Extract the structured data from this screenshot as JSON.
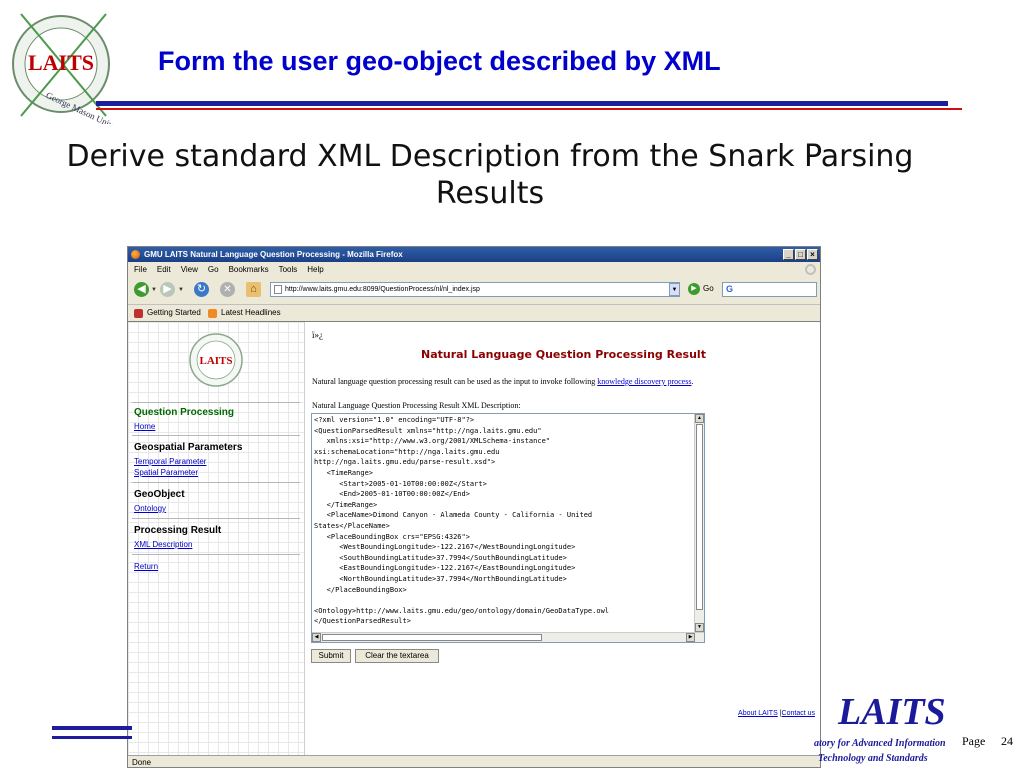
{
  "slide": {
    "title": "Form the user geo-object described by XML",
    "subtitle": "Derive standard XML Description from the Snark Parsing Results",
    "logo_text": "LAITS",
    "logo_ring_text": "George Mason University",
    "footer_brand": "LAITS",
    "footer_org_line1": "atory for Advanced Information",
    "footer_org_line2": "Technology and Standards",
    "page_label": "Page",
    "page_number": "24"
  },
  "browser": {
    "window_title": "GMU LAITS Natural Language Question Processing - Mozilla Firefox",
    "menu": [
      "File",
      "Edit",
      "View",
      "Go",
      "Bookmarks",
      "Tools",
      "Help"
    ],
    "url": "http://www.laits.gmu.edu:8099/QuestionProcess/nl/nl_index.jsp",
    "go_label": "Go",
    "bookmarks": [
      "Getting Started",
      "Latest Headlines"
    ],
    "status": "Done"
  },
  "sidebar": {
    "logo_text": "LAITS",
    "sections": [
      {
        "title": "Question Processing",
        "links": [
          "Home"
        ]
      },
      {
        "title": "Geospatial Parameters",
        "links": [
          "Temporal Parameter",
          "Spatial Parameter"
        ]
      },
      {
        "title": "GeoObject",
        "links": [
          "Ontology"
        ]
      },
      {
        "title": "Processing Result",
        "links": [
          "XML Description"
        ]
      }
    ],
    "return_link": "Return"
  },
  "content": {
    "garbled": "ï»¿",
    "result_title": "Natural Language Question Processing Result",
    "intro_text": "Natural language question processing result can be used as the input to invoke following",
    "intro_link": "knowledge discovery process",
    "intro_end": ".",
    "xml_label": "Natural Language Question Processing Result XML Description:",
    "xml_text": "<?xml version=\"1.0\" encoding=\"UTF-8\"?>\n<QuestionParsedResult xmlns=\"http://nga.laits.gmu.edu\"\n   xmlns:xsi=\"http://www.w3.org/2001/XMLSchema-instance\"\nxsi:schemaLocation=\"http://nga.laits.gmu.edu\nhttp://nga.laits.gmu.edu/parse-result.xsd\">\n   <TimeRange>\n      <Start>2005-01-10T00:00:00Z</Start>\n      <End>2005-01-10T00:00:00Z</End>\n   </TimeRange>\n   <PlaceName>Dimond Canyon - Alameda County - California - United\nStates</PlaceName>\n   <PlaceBoundingBox crs=\"EPSG:4326\">\n      <WestBoundingLongitude>-122.2167</WestBoundingLongitude>\n      <SouthBoundingLatitude>37.7994</SouthBoundingLatitude>\n      <EastBoundingLongitude>-122.2167</EastBoundingLongitude>\n      <NorthBoundingLatitude>37.7994</NorthBoundingLatitude>\n   </PlaceBoundingBox>\n\n<Ontology>http://www.laits.gmu.edu/geo/ontology/domain/GeoDataType.owl\n</QuestionParsedResult>",
    "submit_label": "Submit",
    "clear_label": "Clear the textarea",
    "about_link": "About LAITS",
    "link_separator": "|",
    "contact_link": "Contact us"
  }
}
